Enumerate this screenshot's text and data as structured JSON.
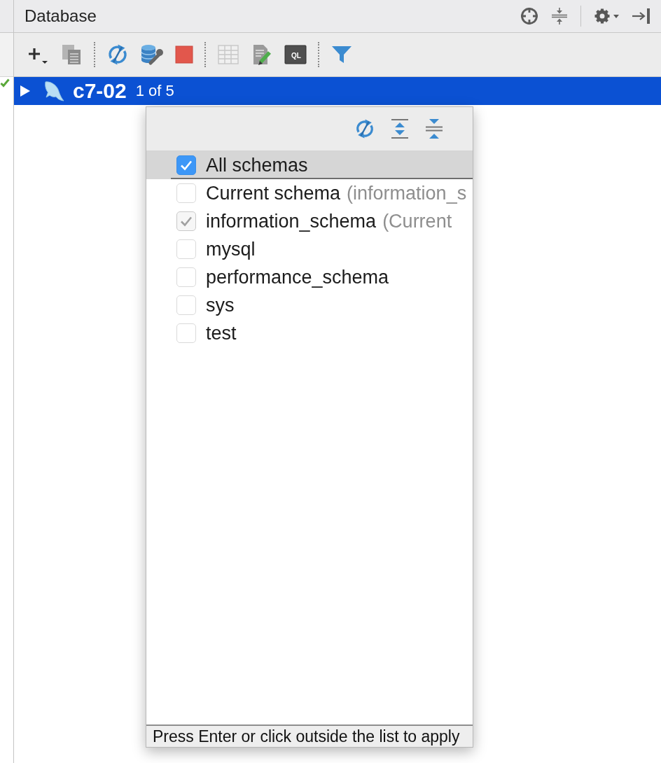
{
  "panel": {
    "title": "Database",
    "actions": [
      {
        "kind": "locate"
      },
      {
        "kind": "collapse"
      },
      {
        "kind": "separator"
      },
      {
        "kind": "settings"
      },
      {
        "kind": "hide"
      }
    ]
  },
  "toolbar": [
    {
      "kind": "add",
      "disabled": false
    },
    {
      "kind": "duplicate",
      "disabled": false
    },
    {
      "kind": "separator"
    },
    {
      "kind": "refresh",
      "disabled": false
    },
    {
      "kind": "properties",
      "disabled": false
    },
    {
      "kind": "stop",
      "disabled": false
    },
    {
      "kind": "separator"
    },
    {
      "kind": "table",
      "disabled": true
    },
    {
      "kind": "edit",
      "disabled": false
    },
    {
      "kind": "console",
      "label": "QL",
      "disabled": false
    },
    {
      "kind": "separator"
    },
    {
      "kind": "filter",
      "disabled": false
    }
  ],
  "tree": [
    {
      "label": "c7-02",
      "count": "1 of 5",
      "expanded": false,
      "selected": true
    }
  ],
  "schema_popup": {
    "actions": [
      {
        "kind": "refresh"
      },
      {
        "kind": "expand_all"
      },
      {
        "kind": "collapse_all"
      }
    ],
    "items": [
      {
        "name": "All schemas",
        "checked": true,
        "disabled": false,
        "selected": true
      },
      {
        "name": "Current schema",
        "note": "(information_s",
        "checked": false,
        "disabled": false,
        "selected": false
      },
      {
        "name": "information_schema",
        "note": "(Current",
        "checked": true,
        "disabled": true,
        "selected": false
      },
      {
        "name": "mysql",
        "checked": false,
        "disabled": false,
        "selected": false
      },
      {
        "name": "performance_schema",
        "checked": false,
        "disabled": false,
        "selected": false
      },
      {
        "name": "sys",
        "checked": false,
        "disabled": false,
        "selected": false
      },
      {
        "name": "test",
        "checked": false,
        "disabled": false,
        "selected": false
      }
    ],
    "footer": "Press Enter or click outside the list to apply"
  }
}
